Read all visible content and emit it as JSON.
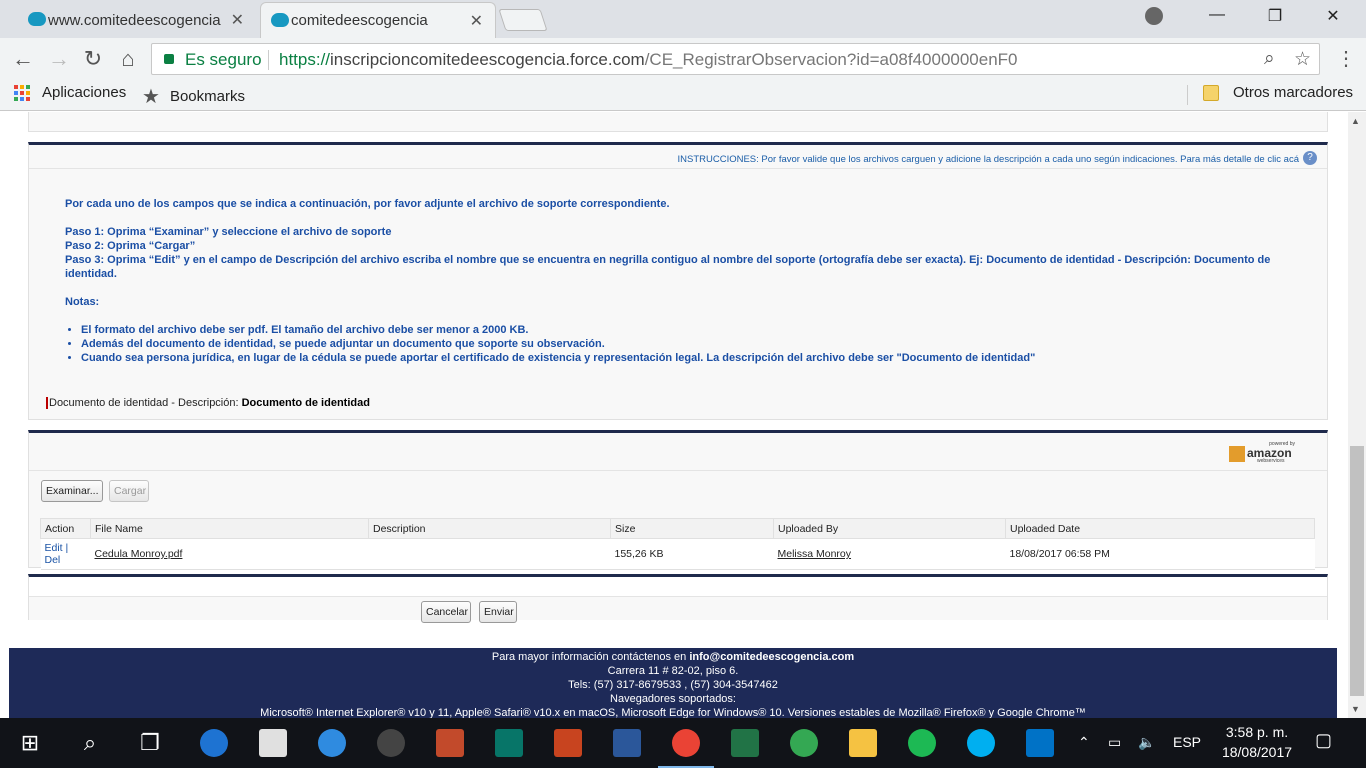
{
  "browser": {
    "tabs": [
      {
        "title": "www.comitedeescogencia",
        "active": false
      },
      {
        "title": "comitedeescogencia",
        "active": true
      }
    ],
    "secure_label": "Es seguro",
    "url_proto": "https://",
    "url_host": "inscripcioncomitedeescogencia.force.com",
    "url_path": "/CE_RegistrarObservacion?id=a08f4000000enF0",
    "bookmarks": {
      "apps": "Aplicaciones",
      "bookmarks": "Bookmarks",
      "others": "Otros marcadores"
    }
  },
  "page": {
    "instructions_title": "INSTRUCCIONES: Por favor valide que los archivos carguen y adicione la descripción a cada uno según indicaciones. Para más detalle de clic acá",
    "help_label": "?",
    "intro": "Por cada uno de los campos que se indica a continuación, por favor adjunte el archivo de soporte correspondiente.",
    "step1": "Paso 1: Oprima “Examinar” y seleccione el archivo de soporte",
    "step2": "Paso 2: Oprima “Cargar”",
    "step3": "Paso 3: Oprima “Edit” y en el campo de Descripción del archivo escriba el nombre que se encuentra en negrilla contiguo al nombre del soporte (ortografía debe ser exacta). Ej: Documento de identidad - Descripción: Documento de identidad.",
    "notes_title": "Notas:",
    "notes": [
      "El formato del archivo debe ser pdf. El tamaño del archivo debe ser menor a 2000 KB.",
      "Además del documento de identidad, se puede adjuntar un documento que soporte su observación.",
      "Cuando sea persona jurídica, en lugar de la cédula se puede aportar el certificado de existencia y representación legal. La descripción del archivo debe ser \"Documento de identidad\""
    ],
    "doc_label": "Documento de identidad - Descripción: ",
    "doc_value": "Documento de identidad",
    "aws": {
      "powered": "powered by",
      "amazon": "amazon",
      "webservices": "webservices"
    },
    "browse_button": "Examinar...",
    "upload_button": "Cargar",
    "table": {
      "headers": [
        "Action",
        "File Name",
        "Description",
        "Size",
        "Uploaded By",
        "Uploaded Date"
      ],
      "rows": [
        {
          "edit": "Edit",
          "sep": " | ",
          "del": "Del",
          "file": "Cedula Monroy.pdf",
          "description": "",
          "size": "155,26 KB",
          "by": "Melissa Monroy",
          "date": "18/08/2017 06:58 PM"
        }
      ]
    },
    "cancel_button": "Cancelar",
    "send_button": "Enviar",
    "footer": {
      "line1_prefix": "Para mayor información contáctenos  en ",
      "line1_email": "info@comitedeescogencia.com",
      "line2": "Carrera 11 # 82-02, piso 6.",
      "line3": "Tels: (57) 317-8679533 , (57) 304-3547462",
      "line4": "Navegadores soportados:",
      "line5": "Microsoft® Internet Explorer® v10 y 11, Apple® Safari® v10.x en macOS, Microsoft Edge for Windows® 10. Versiones estables de Mozilla® Firefox® y Google Chrome™"
    }
  },
  "taskbar": {
    "language": "ESP",
    "time": "3:58 p. m.",
    "date": "18/08/2017"
  },
  "colors": {
    "navy": "#1f2a4c",
    "link_blue": "#1b4fa5",
    "secure_green": "#0b8043"
  }
}
